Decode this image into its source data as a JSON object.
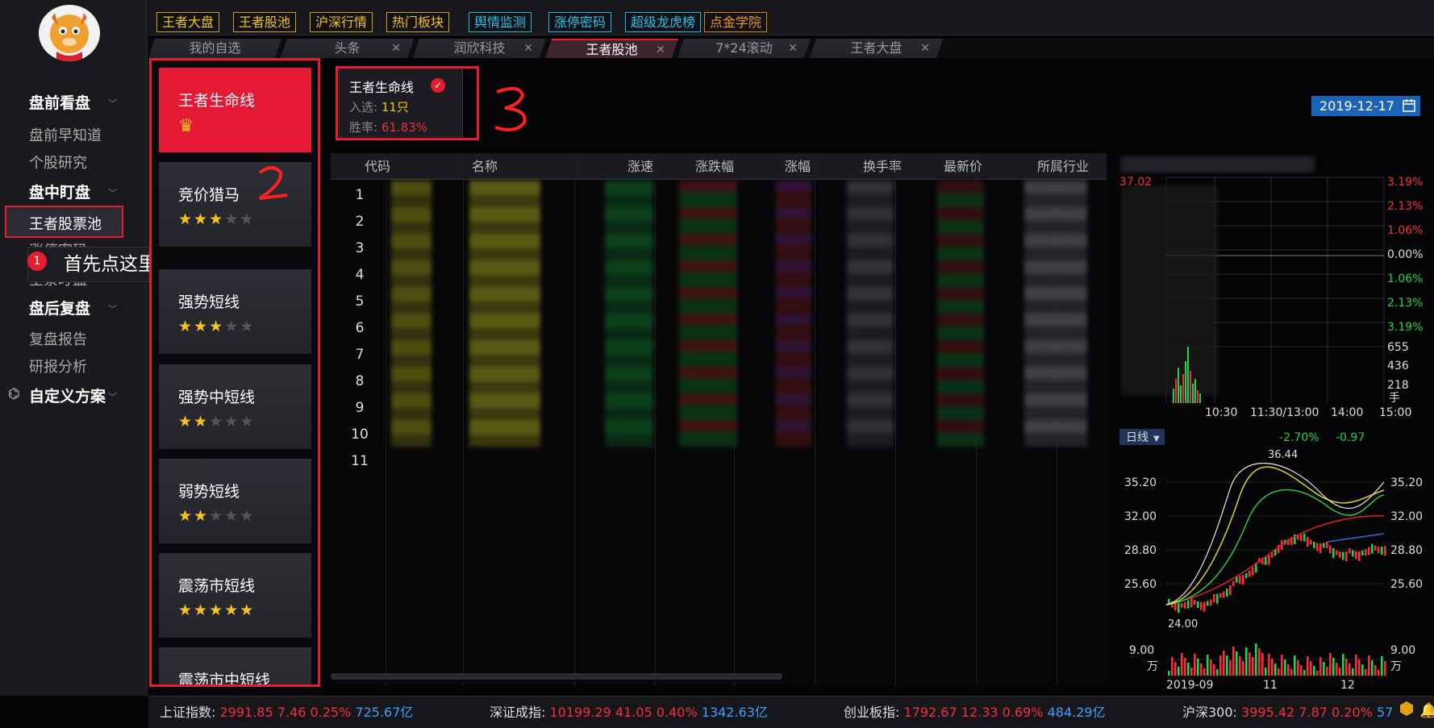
{
  "topbar": {
    "buttons": [
      "王者大盘",
      "王者股池",
      "沪深行情",
      "热门板块",
      "舆情监测",
      "涨停密码",
      "超级龙虎榜",
      "点金学院"
    ]
  },
  "tabs": [
    {
      "label": "我的自选"
    },
    {
      "label": "头条"
    },
    {
      "label": "润欣科技"
    },
    {
      "label": "王者股池"
    },
    {
      "label": "7*24滚动"
    },
    {
      "label": "王者大盘"
    }
  ],
  "sidebar": {
    "pre_market": "盘前看盘",
    "pre_items": [
      "盘前早知道",
      "个股研究"
    ],
    "intraday": "盘中盯盘",
    "intraday_items": [
      "王者股票池",
      "涨停密码",
      "全景盯盘"
    ],
    "post_market": "盘后复盘",
    "post_items": [
      "复盘报告",
      "研报分析"
    ],
    "custom": "自定义方案",
    "tooltip_badge": "1",
    "tooltip_text": "首先点这里"
  },
  "strategies": [
    {
      "title": "王者生命线",
      "stars": 0,
      "crown": true
    },
    {
      "title": "竞价猎马",
      "stars": 3
    },
    {
      "title": "强势短线",
      "stars": 3
    },
    {
      "title": "强势中短线",
      "stars": 2
    },
    {
      "title": "弱势短线",
      "stars": 2
    },
    {
      "title": "震荡市短线",
      "stars": 5
    },
    {
      "title": "震荡市中短线",
      "stars": 0
    }
  ],
  "pool": {
    "title": "王者生命线",
    "selected_label": "入选:",
    "selected_value": "11只",
    "winrate_label": "胜率:",
    "winrate_value": "61.83%"
  },
  "date": "2019-12-17",
  "annotations": {
    "two": "2",
    "three": "3"
  },
  "table": {
    "headers": [
      "代码",
      "名称",
      "涨速",
      "涨跌幅",
      "涨幅",
      "换手率",
      "最新价",
      "所属行业"
    ],
    "rows": [
      "1",
      "2",
      "3",
      "4",
      "5",
      "6",
      "7",
      "8",
      "9",
      "10",
      "11"
    ]
  },
  "intraday_chart": {
    "price_top": "37.02",
    "pct_labels": [
      "3.19%",
      "2.13%",
      "1.06%",
      "0.00%",
      "1.06%",
      "2.13%",
      "3.19%"
    ],
    "vol_labels": [
      "655",
      "436",
      "218",
      "手"
    ],
    "time_labels": [
      "10:30",
      "11:30/13:00",
      "14:00",
      "15:00"
    ]
  },
  "daily_chart": {
    "period": "日线",
    "chg_pct": "-2.70%",
    "chg_val": "-0.97",
    "high_mark": "36.44",
    "low_mark": "24.00",
    "y_labels": [
      "35.20",
      "32.00",
      "28.80",
      "25.60"
    ],
    "vol_label": "9.00",
    "vol_unit": "万",
    "date_labels": [
      "2019-09",
      "11",
      "12"
    ]
  },
  "status": {
    "sh_label": "上证指数:",
    "sh_val": "2991.85",
    "sh_chg": "7.46",
    "sh_pct": "0.25%",
    "sh_amt": "725.67亿",
    "sz_label": "深证成指:",
    "sz_val": "10199.29",
    "sz_chg": "41.05",
    "sz_pct": "0.40%",
    "sz_amt": "1342.63亿",
    "cy_label": "创业板指:",
    "cy_val": "1792.67",
    "cy_chg": "12.33",
    "cy_pct": "0.69%",
    "cy_amt": "484.29亿",
    "hs_label": "沪深300:",
    "hs_val": "3995.42",
    "hs_chg": "7.87",
    "hs_pct": "0.20%",
    "hs_amt": "57"
  },
  "colors": {
    "accent": "#e81c2f",
    "gold": "#f2c318",
    "cyan": "#26c3ef",
    "orange": "#ef9620",
    "blue": "#1b63b8"
  }
}
